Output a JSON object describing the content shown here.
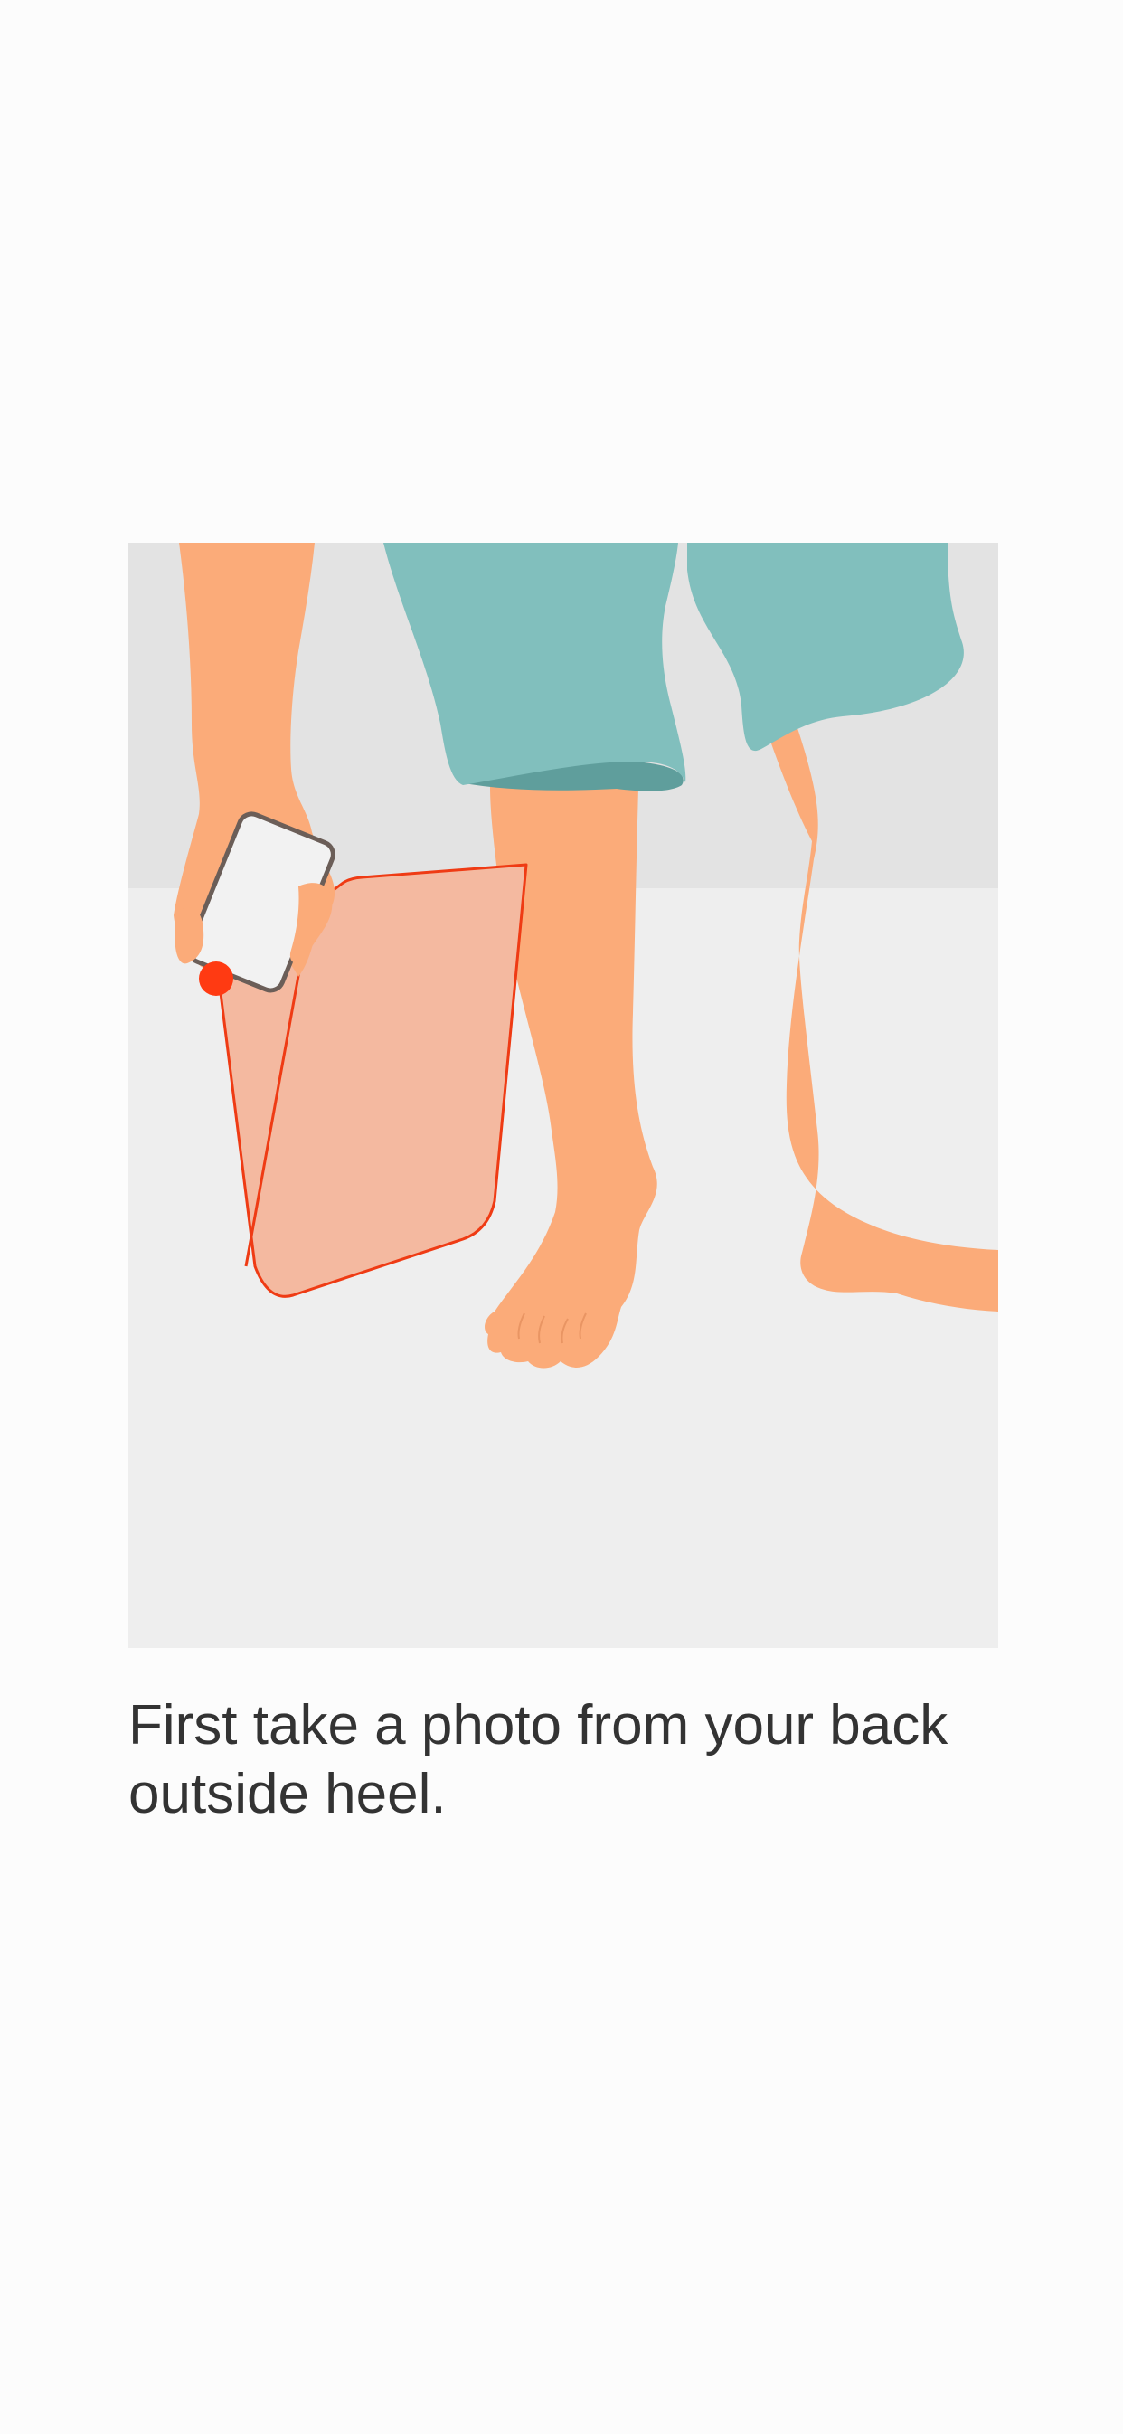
{
  "instruction": {
    "text": "First take a photo from your back outside heel."
  },
  "illustration": {
    "subject": "leg-and-phone-illustration",
    "colors": {
      "wall": "#e3e3e3",
      "floor": "#eeeeee",
      "skin": "#fbab79",
      "shorts": "#81bfbd",
      "shorts_shadow": "#5f9e9c",
      "phone_outline": "#6b5e58",
      "phone_screen": "#f2f2f2",
      "camera_dot": "#ff3a12",
      "view_frustum_line": "#ef3b14",
      "view_frustum_fill": "#f4b9a0",
      "text": "#333333"
    }
  }
}
